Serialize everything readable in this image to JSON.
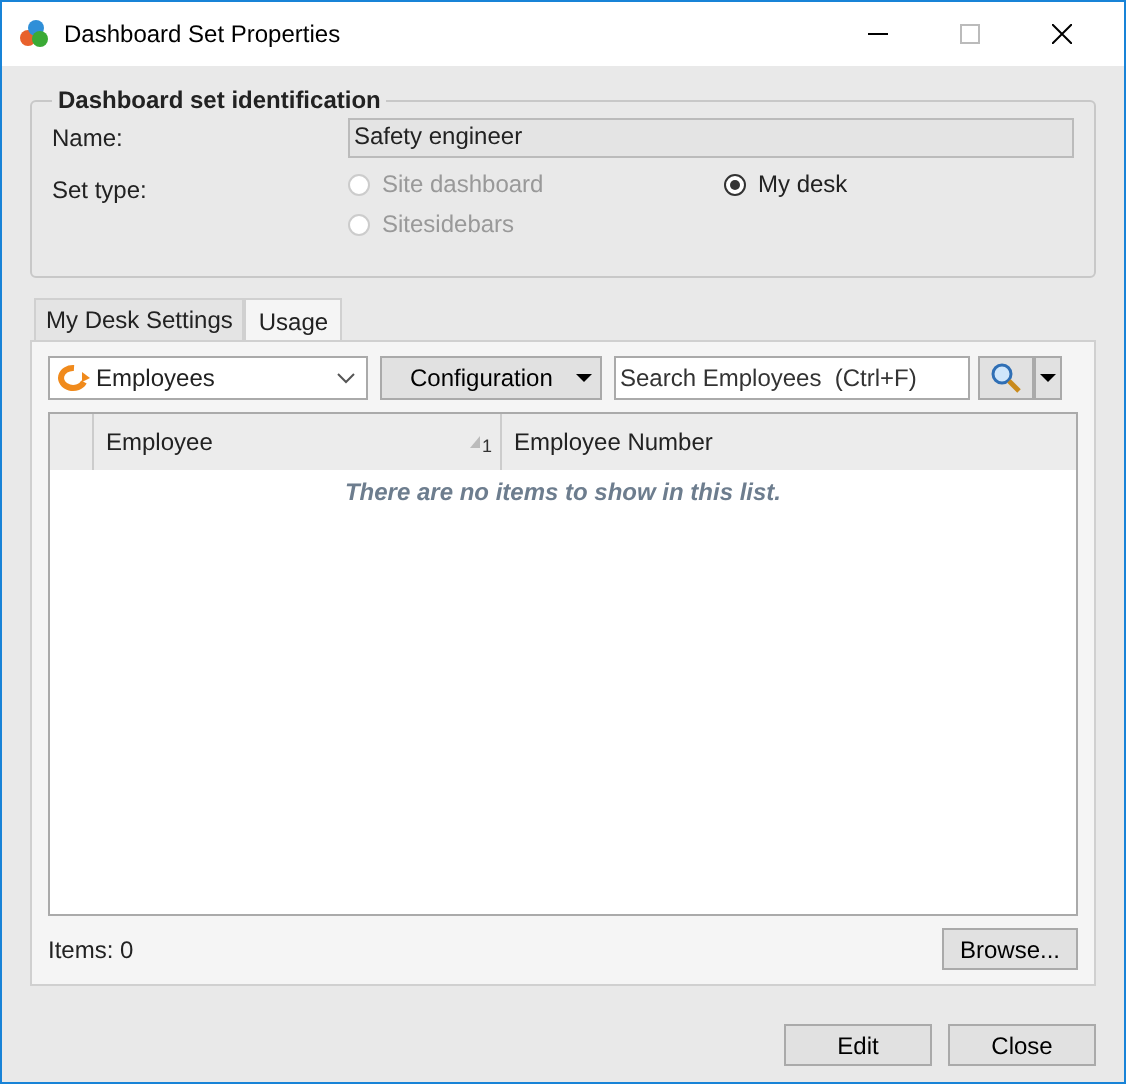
{
  "window": {
    "title": "Dashboard Set Properties"
  },
  "identification": {
    "title": "Dashboard set identification",
    "name_label": "Name:",
    "name_value": "Safety engineer",
    "set_type_label": "Set type:",
    "set_types": [
      {
        "label": "Site dashboard",
        "selected": false,
        "disabled": true
      },
      {
        "label": "My desk",
        "selected": true,
        "disabled": false
      },
      {
        "label": "Sitesidebars",
        "selected": false,
        "disabled": true
      }
    ]
  },
  "tabs": [
    {
      "label": "My Desk Settings",
      "selected": false
    },
    {
      "label": "Usage",
      "selected": true
    }
  ],
  "toolbar": {
    "entity": "Employees",
    "configuration": "Configuration",
    "search": {
      "placeholder": "Search Employees  (Ctrl+F)"
    }
  },
  "table": {
    "columns": [
      {
        "label": "Employee",
        "sort_order": "1"
      },
      {
        "label": "Employee Number"
      }
    ],
    "empty_message": "There are no items to show in this list."
  },
  "items_count": "Items: 0",
  "browse": "Browse...",
  "buttons": [
    "Edit",
    "Close"
  ]
}
